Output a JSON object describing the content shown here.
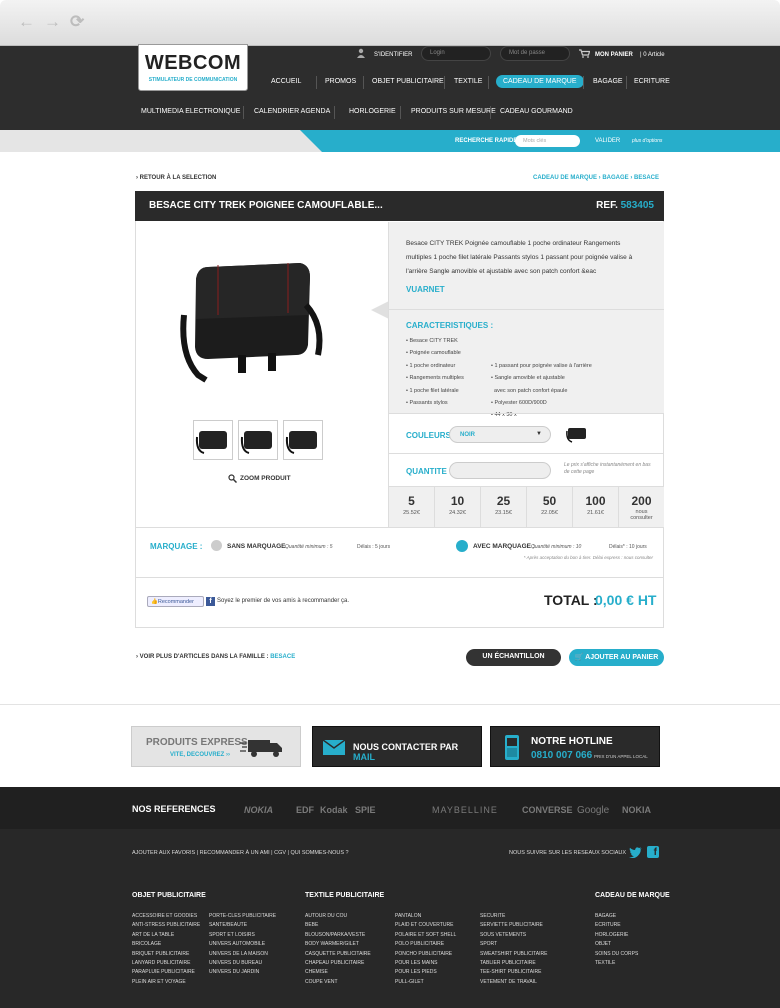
{
  "browser": {
    "back": "←",
    "forward": "→",
    "reload": "⟳"
  },
  "header": {
    "logo_title": "WEBCOM",
    "logo_subtitle": "STIMULATEUR DE COMMUNICATION",
    "login_label": "S'IDENTIFIER",
    "login_placeholder": "Login",
    "password_placeholder": "Mot de passe",
    "cart_label": "MON PANIER",
    "cart_count": "0 Article",
    "menu_primary": [
      "ACCUEIL",
      "PROMOS",
      "OBJET PUBLICITAIRE",
      "TEXTILE",
      "CADEAU DE MARQUE",
      "BAGAGE",
      "ECRITURE"
    ],
    "menu_secondary": [
      "MULTIMEDIA ELECTRONIQUE",
      "CALENDRIER AGENDA",
      "HORLOGERIE",
      "PRODUITS SUR MESURE",
      "CADEAU GOURMAND"
    ]
  },
  "search": {
    "label": "RECHERCHE RAPIDE",
    "placeholder": "Mots clés",
    "submit": "VALIDER",
    "options": "plus d'options"
  },
  "breadcrumb": {
    "back": "› RETOUR À LA SELECTION",
    "path": "CADEAU DE MARQUE › BAGAGE › BESACE"
  },
  "product": {
    "title": "BESACE CITY TREK POIGNEE CAMOUFLABLE...",
    "ref_label": "REF.",
    "ref_value": "583405",
    "description": "Besace CITY TREK Poignée camouflable 1 poche ordinateur Rangements multiples 1 poche filet latérale Passants stylos 1 passant pour poignée valise à l'arrière Sangle amovible et ajustable avec son patch confort &eac",
    "brand": "VUARNET",
    "zoom": "ZOOM PRODUIT",
    "features_title": "CARACTERISTIQUES :",
    "features_left": [
      "• Besace CITY TREK",
      "• Poignée camouflable",
      "• 1 poche ordinateur",
      "• Rangements multiples",
      "• 1 poche filet latérale",
      "• Passants stylos"
    ],
    "features_right": [
      "• 1 passant pour poignée valise à l'arrière",
      "• Sangle amovible et ajustable",
      "  avec son patch confort épaule",
      "• Polyester 600D/900D",
      "• 44 x 30 x"
    ],
    "colors_label": "COULEURS :",
    "color_value": "NOIR",
    "qty_label": "QUANTITE :",
    "qty_note": "Le prix s'affiche instantanément en bas de cette page",
    "prices": [
      {
        "qty": "5",
        "price": "25.52€"
      },
      {
        "qty": "10",
        "price": "24.32€"
      },
      {
        "qty": "25",
        "price": "23.15€"
      },
      {
        "qty": "50",
        "price": "22.05€"
      },
      {
        "qty": "100",
        "price": "21.61€"
      },
      {
        "qty": "200",
        "price": "nous consulter"
      }
    ],
    "marking_label": "MARQUAGE :",
    "marking_without": "SANS MARQUAGE",
    "marking_without_min": "Quantité minimum : 5",
    "marking_without_delay": "Délais : 5 jours",
    "marking_with": "AVEC MARQUAGE :",
    "marking_with_min": "Quantité minimum : 10",
    "marking_with_delay": "Délais* : 10 jours",
    "marking_note": "* Après acceptation du bon à tirer. Délai express : nous consulter",
    "recommend_btn": "Recommander",
    "recommend_text": "Soyez le premier de vos amis à recommander ça.",
    "total_label": "TOTAL :",
    "total_value": "0,00 € HT"
  },
  "family": {
    "label": "› VOIR PLUS D'ARTICLES DANS LA FAMILLE :",
    "value": "BESACE"
  },
  "actions": {
    "sample": "UN ÉCHANTILLON",
    "add_cart": "AJOUTER AU PANIER"
  },
  "banners": {
    "express_title": "PRODUITS EXPRESS",
    "express_sub": "VITE, DECOUVREZ ››",
    "contact_prefix": "NOUS CONTACTER PAR",
    "contact_mail": "MAIL",
    "hotline_title": "NOTRE HOTLINE",
    "hotline_number": "0810 007 066",
    "hotline_note": "PRIX D'UN APPEL LOCAL"
  },
  "footer": {
    "refs_title": "NOS REFERENCES",
    "refs": [
      "NOKIA",
      "EDF",
      "Kodak",
      "SPIE",
      "MAYBELLINE",
      "CONVERSE",
      "Google",
      "NOKIA"
    ],
    "links_line": "AJOUTER AUX FAVORIS | RECOMMANDER À UN AMI | CGV | QUI SOMMES-NOUS ?",
    "social_label": "NOUS SUIVRE SUR LES RESEAUX SOCIAUX",
    "col1_title": "OBJET PUBLICITAIRE",
    "col1a": [
      "ACCESSOIRE ET GOODIES",
      "ANTI-STRESS PUBLICITAIRE",
      "ART DE LA TABLE",
      "BRICOLAGE",
      "BRIQUET PUBLICITAIRE",
      "LANYARD PUBLICITAIRE",
      "PARAPLUIE PUBLICITAIRE",
      "PLEIN AIR ET VOYAGE"
    ],
    "col1b": [
      "PORTE-CLES PUBLICITAIRE",
      "SANTE/BEAUTE",
      "SPORT ET LOISIRS",
      "UNIVERS AUTOMOBILE",
      "UNIVERS DE LA MAISON",
      "UNIVERS DU BUREAU",
      "UNIVERS DU JARDIN"
    ],
    "col2_title": "TEXTILE PUBLICITAIRE",
    "col2a": [
      "AUTOUR DU COU",
      "BEBE",
      "BLOUSON/PARKA/VESTE",
      "BODY WARMER/GILET",
      "CASQUETTE PUBLICITAIRE",
      "CHAPEAU PUBLICITAIRE",
      "CHEMISE",
      "COUPE VENT"
    ],
    "col2b": [
      "PANTALON",
      "PLAID ET COUVERTURE",
      "POLAIRE ET SOFT SHELL",
      "POLO PUBLICITAIRE",
      "PONCHO PUBLICITAIRE",
      "POUR LES MAINS",
      "POUR LES PIEDS",
      "PULL-GILET"
    ],
    "col2c": [
      "SECURITE",
      "SERVIETTE PUBLICITAIRE",
      "SOUS VETEMENTS",
      "SPORT",
      "SWEATSHIRT PUBLICITAIRE",
      "TABLIER PUBLICITAIRE",
      "TEE-SHIRT PUBLICITAIRE",
      "VETEMENT DE TRAVAIL"
    ],
    "col3_title": "CADEAU DE MARQUE",
    "col3": [
      "BAGAGE",
      "ECRITURE",
      "HORLOGERIE",
      "OBJET",
      "SOINS DU CORPS",
      "TEXTILE"
    ]
  },
  "colors": {
    "accent": "#27aecb",
    "dark": "#2d2d2d"
  }
}
